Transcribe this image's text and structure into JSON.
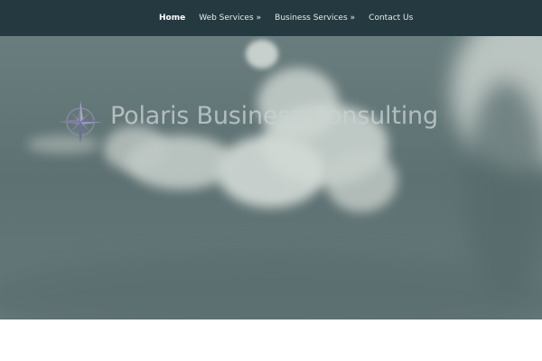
{
  "nav": {
    "items": [
      {
        "label": "Home",
        "active": true
      },
      {
        "label": "Web Services",
        "suffix": "»"
      },
      {
        "label": "Business Services",
        "suffix": "»"
      },
      {
        "label": "Contact Us"
      }
    ]
  },
  "hero": {
    "brand_text": "Polaris Business Consulting",
    "logo_icon": "compass-rose-icon"
  },
  "colors": {
    "navbar": "#253a40",
    "hero_sky": "#5f7273",
    "brand_text": "#c9d2d4"
  }
}
